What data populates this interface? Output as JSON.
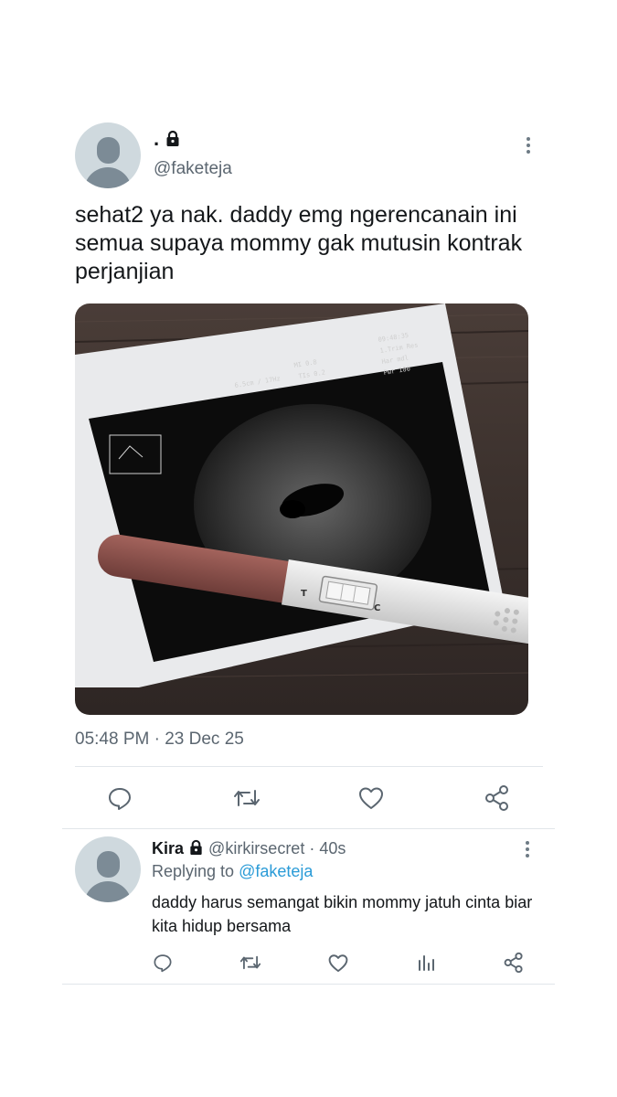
{
  "main_tweet": {
    "display_name": ".",
    "handle": "@faketeja",
    "text": "sehat2 ya nak. daddy emg ngerencanain ini semua supaya mommy gak mutusin kontrak perjanjian",
    "image_icon": "ultrasound-photo-with-pregnancy-test",
    "pregnancy_test_labels": {
      "t": "T",
      "c": "C"
    },
    "timestamp": "05:48 PM · 23 Dec 25",
    "actions": [
      "reply-icon",
      "retweet-icon",
      "like-icon",
      "share-icon"
    ]
  },
  "reply": {
    "display_name": "Kira",
    "handle": "@kirkirsecret",
    "time": "· 40s",
    "replying_prefix": "Replying to",
    "replying_handle": "@faketeja",
    "text": "daddy harus semangat bikin mommy jatuh cinta biar kita hidup bersama",
    "actions": [
      "reply-icon",
      "retweet-icon",
      "like-icon",
      "analytics-icon",
      "share-icon"
    ]
  },
  "colors": {
    "text": "#14171a",
    "secondary": "#5b6670",
    "link": "#2a9bd7",
    "icon": "#5b6670",
    "divider": "#e1e6ea"
  }
}
